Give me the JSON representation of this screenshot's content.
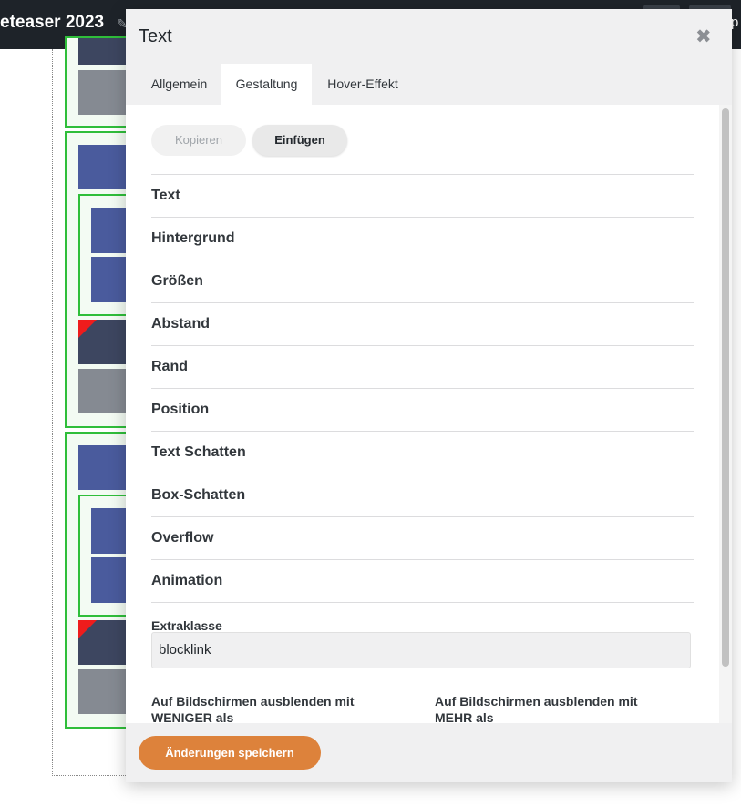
{
  "page": {
    "title_fragment": "eteaser 2023",
    "right_edge_text": "p",
    "pencil_glyph": "✎"
  },
  "modal": {
    "title": "Text",
    "close_glyph": "✖",
    "tabs": [
      {
        "label": "Allgemein",
        "active": false
      },
      {
        "label": "Gestaltung",
        "active": true
      },
      {
        "label": "Hover-Effekt",
        "active": false
      }
    ],
    "copy_button": "Kopieren",
    "paste_button": "Einfügen",
    "sections": [
      "Text",
      "Hintergrund",
      "Größen",
      "Abstand",
      "Rand",
      "Position",
      "Text Schatten",
      "Box-Schatten",
      "Overflow",
      "Animation"
    ],
    "extra_class_label": "Extraklasse",
    "extra_class_value": "blocklink",
    "hide_less_label": "Auf Bildschirmen ausblenden mit WENIGER als",
    "hide_more_label": "Auf Bildschirmen ausblenden mit MEHR als",
    "save_button": "Änderungen speichern"
  },
  "colors": {
    "accent": "#dd823b",
    "group_border": "#2fbe3a",
    "block_blue": "#4a5b9d",
    "block_dark": "#3d4660",
    "block_gray": "#858a92",
    "corner_red": "#ee1c1c",
    "topbar": "#1e2329"
  }
}
